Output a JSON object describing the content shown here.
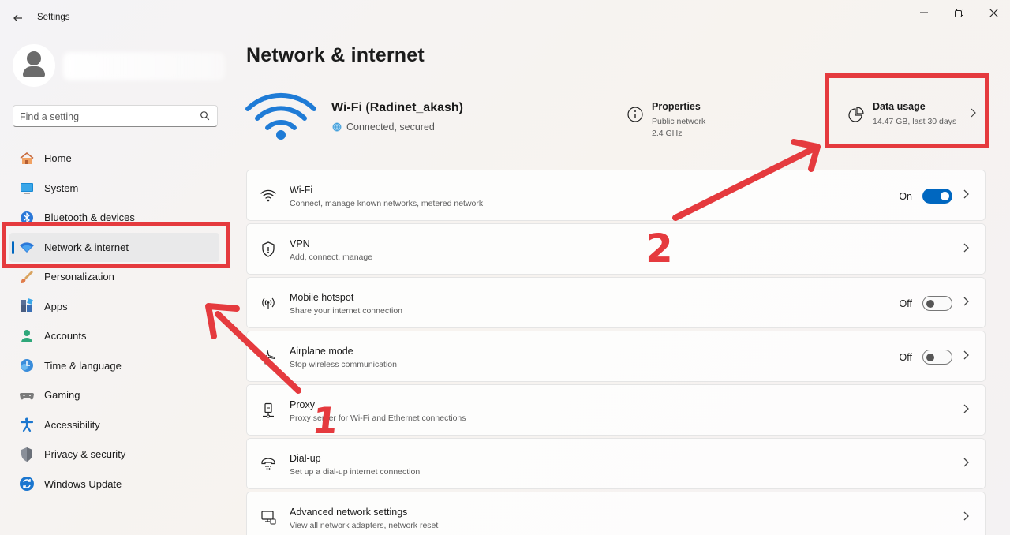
{
  "window": {
    "title": "Settings"
  },
  "search": {
    "placeholder": "Find a setting"
  },
  "sidebar": {
    "items": [
      {
        "label": "Home",
        "icon": "home-icon"
      },
      {
        "label": "System",
        "icon": "system-icon"
      },
      {
        "label": "Bluetooth & devices",
        "icon": "bluetooth-icon"
      },
      {
        "label": "Network & internet",
        "icon": "network-icon",
        "active": true
      },
      {
        "label": "Personalization",
        "icon": "brush-icon"
      },
      {
        "label": "Apps",
        "icon": "apps-icon"
      },
      {
        "label": "Accounts",
        "icon": "accounts-icon"
      },
      {
        "label": "Time & language",
        "icon": "time-language-icon"
      },
      {
        "label": "Gaming",
        "icon": "gamepad-icon"
      },
      {
        "label": "Accessibility",
        "icon": "accessibility-icon"
      },
      {
        "label": "Privacy & security",
        "icon": "shield-icon"
      },
      {
        "label": "Windows Update",
        "icon": "update-icon"
      }
    ]
  },
  "main": {
    "title": "Network & internet",
    "connection": {
      "name": "Wi-Fi (Radinet_akash)",
      "status": "Connected, secured"
    },
    "properties": {
      "title": "Properties",
      "line1": "Public network",
      "line2": "2.4 GHz"
    },
    "data_usage": {
      "title": "Data usage",
      "summary": "14.47 GB, last 30 days"
    },
    "cards": [
      {
        "title": "Wi-Fi",
        "subtitle": "Connect, manage known networks, metered network",
        "state": "On",
        "toggle": "on",
        "icon": "wifi-icon"
      },
      {
        "title": "VPN",
        "subtitle": "Add, connect, manage",
        "icon": "vpn-shield-icon"
      },
      {
        "title": "Mobile hotspot",
        "subtitle": "Share your internet connection",
        "state": "Off",
        "toggle": "off",
        "icon": "hotspot-icon"
      },
      {
        "title": "Airplane mode",
        "subtitle": "Stop wireless communication",
        "state": "Off",
        "toggle": "off",
        "icon": "airplane-icon"
      },
      {
        "title": "Proxy",
        "subtitle": "Proxy server for Wi-Fi and Ethernet connections",
        "icon": "proxy-icon"
      },
      {
        "title": "Dial-up",
        "subtitle": "Set up a dial-up internet connection",
        "icon": "dialup-icon"
      },
      {
        "title": "Advanced network settings",
        "subtitle": "View all network adapters, network reset",
        "icon": "advanced-network-icon"
      }
    ]
  },
  "annotations": {
    "step1": "1",
    "step2": "2",
    "color": "#e53a3e"
  },
  "colors": {
    "accent": "#0067c0"
  }
}
